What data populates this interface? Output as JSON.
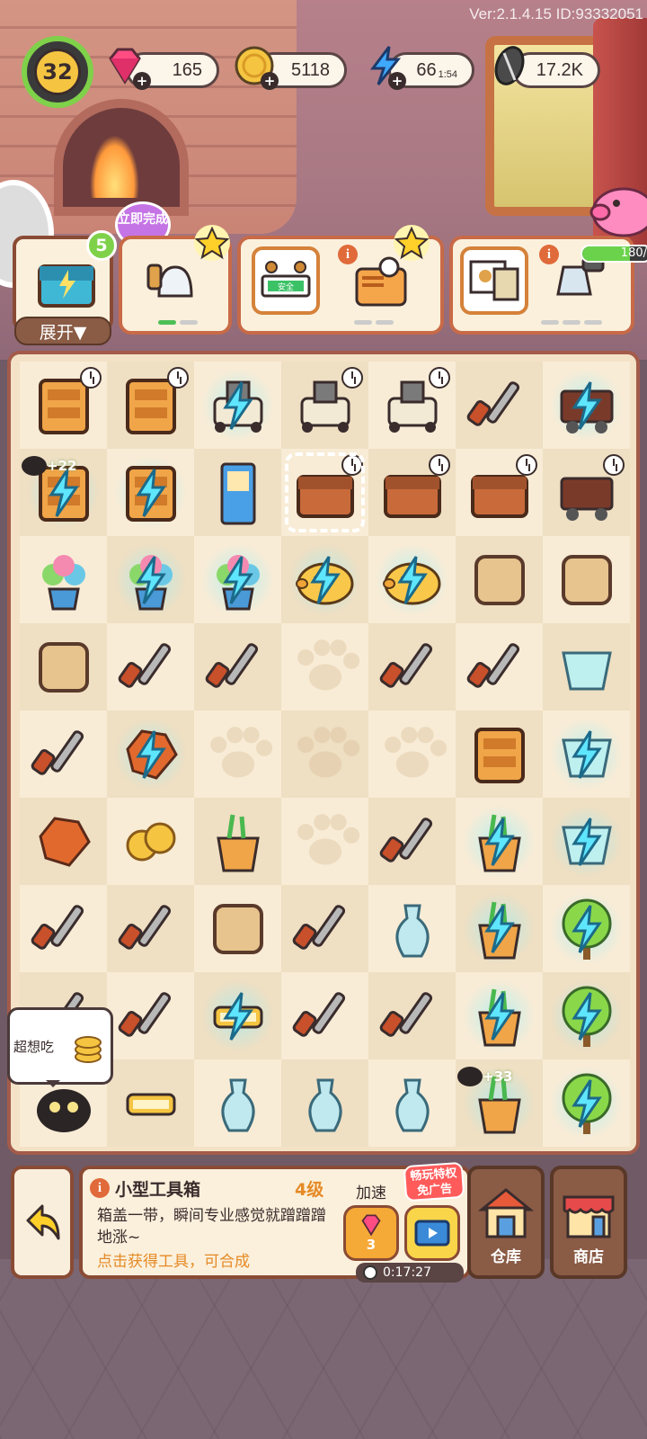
{
  "version_text": "Ver:2.1.4.15 ID:93332051",
  "player": {
    "level": "32"
  },
  "resources": [
    {
      "name": "gems",
      "icon": "gem-icon",
      "value": "165"
    },
    {
      "name": "coins",
      "icon": "coin-icon",
      "value": "5118"
    },
    {
      "name": "energy",
      "icon": "lightning-icon",
      "value": "66",
      "timer": "1:54"
    },
    {
      "name": "seeds",
      "icon": "seed-icon",
      "value": "17.2K"
    }
  ],
  "chest": {
    "count": "5",
    "expand_label": "展开▼"
  },
  "instant_complete_label": "立即完成",
  "piggy_bank": {
    "progress_label": "180/",
    "fill_fraction": 0.7
  },
  "orders": [
    {
      "item": "wall-bell-icon",
      "progress": [
        true,
        false
      ]
    },
    {
      "item": "exit-sign-icon",
      "sign_text": "安全"
    },
    {
      "item": "radio-icon",
      "progress": [
        false,
        false
      ]
    },
    {
      "item": "photo-frame-icon"
    },
    {
      "item": "flashlight-lamp-icon",
      "progress": [
        false,
        false,
        false
      ]
    }
  ],
  "board": {
    "rows": [
      [
        "dresser-icon",
        "cabinet-icon",
        "robot-vacuum-charging-icon",
        "robot-vacuum-icon",
        "robot-vacuum-icon",
        "pipes-icon",
        "wheelbarrow-charging-icon"
      ],
      [
        "folding-screen-charging-icon",
        "glass-cabinet-charging-icon",
        "arcade-machine-icon",
        "toolbox-icon",
        "open-toolbox-icon",
        "open-chest-icon",
        "mine-cart-icon"
      ],
      [
        "flower-pot-icon",
        "plant-charging-icon",
        "plant-charging-icon",
        "piggy-bank-charging-icon",
        "piggy-bank-charging-icon",
        "metal-plates-icon",
        "pocket-watch-icon"
      ],
      [
        "watering-can-icon",
        "paint-brush-icon",
        "wrench-icon",
        "empty",
        "screw-icon",
        "pipe-fitting-icon",
        "glass-panel-icon"
      ],
      [
        "syringes-icon",
        "rock-charging-icon",
        "empty",
        "empty",
        "empty",
        "wooden-tray-icon",
        "glass-bowl-charging-icon"
      ],
      [
        "ruby-ore-icon",
        "coins-stack-icon",
        "broken-pot-icon",
        "empty",
        "screws-icon",
        "pot-charging-icon",
        "glass-bowl-charging-icon"
      ],
      [
        "hammer-icon",
        "level-tool-icon",
        "wood-chunk-icon",
        "shovel-icon",
        "vase-sprout-icon",
        "pot-charging-icon",
        "tree-charging-icon"
      ],
      [
        "pruning-shears-icon",
        "paint-roller-icon",
        "lamp-charging-icon",
        "pitchfork-icon",
        "flashlight-icon",
        "pot-charging-icon",
        "tree-charging-icon"
      ],
      [
        "cat-icon",
        "lamp-icon",
        "glass-vase-icon",
        "glass-vase-icon",
        "flower-vase-icon",
        "pot-glowing-icon",
        "tree-charging-icon"
      ]
    ],
    "badges": [
      {
        "label": "+22"
      },
      {
        "label": "+33"
      }
    ],
    "speech_bubble": "超想吃"
  },
  "info_panel": {
    "title": "小型工具箱",
    "level": "4级",
    "description": "箱盖一带，瞬间专业感觉就蹭蹭蹭地涨~",
    "hint": "点击获得工具，可合成",
    "speed_label": "加速",
    "gem_cost": "3",
    "ad_badge_line1": "畅玩特权",
    "ad_badge_line2": "免广告",
    "timer": "0:17:27"
  },
  "nav": {
    "warehouse_label": "仓库",
    "shop_label": "商店"
  },
  "colors": {
    "board_bg": "#f4e2c6",
    "accent_orange": "#e58a26",
    "energy_glow": "#8cf0ff",
    "frame_brown": "#8a4b35"
  }
}
